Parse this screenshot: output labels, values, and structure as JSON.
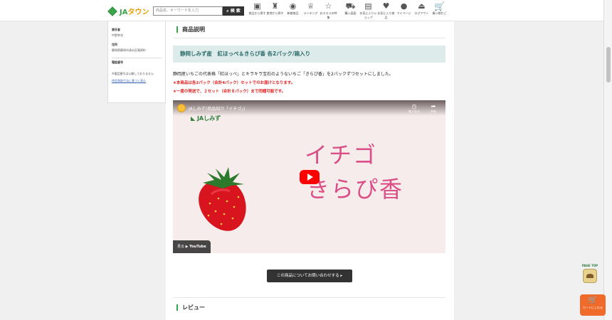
{
  "header": {
    "logo_ja": "JA",
    "logo_town": "タウン",
    "search_placeholder": "商品名、キーワードを入力",
    "search_button": "検 索",
    "nav": [
      {
        "icon": "produce-icon",
        "label": "商品から探す"
      },
      {
        "icon": "region-icon",
        "label": "産地から探す"
      },
      {
        "icon": "new-icon",
        "label": "新着商品"
      },
      {
        "icon": "ranking-icon",
        "label": "ランキング"
      },
      {
        "icon": "recommend-icon",
        "label": "おススメの特集"
      },
      {
        "icon": "cart-icon",
        "label": "購入画面"
      },
      {
        "icon": "shop-icon",
        "label": "お気に入りショップ"
      },
      {
        "icon": "heart-icon",
        "label": "お気に入り商品"
      },
      {
        "icon": "user-icon",
        "label": "マイページ"
      },
      {
        "icon": "logout-icon",
        "label": "ログアウト"
      },
      {
        "icon": "basket-icon",
        "label": "買い物かご"
      }
    ]
  },
  "sidebar": {
    "responsible_label": "責任者",
    "responsible_value": "中野幸也",
    "address_label": "住所",
    "address_value": "静岡県静岡市清水区庵原町",
    "phone_label": "電話番号",
    "phone_note": "※電話番号は公開しておりません",
    "link": "特定商取引法に基づく表示"
  },
  "main": {
    "section_title": "商品説明",
    "product_title": "静岡しみず産　紅ほっぺ＆きらぴ香 各2パック/箱入り",
    "description": "静岡産いちごの代表格「紅ほっぺ」とキラキラ宝石のようないちご「きらぴ香」を2パックずつセットにしました。",
    "note1": "★本商品は各2パック（合計4パック）セットでのお届けとなります。",
    "note2": "★一度の発送で、２セット（合計８パック）まで同梱可能です。",
    "video": {
      "title": "JAしみず(商品紹介「イチゴ」)",
      "action_later": "後で見る",
      "action_share": "共有",
      "brand": "JAしみず",
      "line1": "イチゴ",
      "line2": "きらぴ香",
      "watch_on": "見る",
      "youtube": "YouTube"
    },
    "inquiry_button": "この商品についてお問い合わせする",
    "review_title": "レビュー"
  },
  "widgets": {
    "page_top": "PAGE TOP",
    "cart_fab": "カートに入れる"
  },
  "colors": {
    "accent_green": "#3aa34a",
    "title_band": "#ddeceb",
    "note_red": "#e02020",
    "strawberry_pink": "#d94f86"
  }
}
